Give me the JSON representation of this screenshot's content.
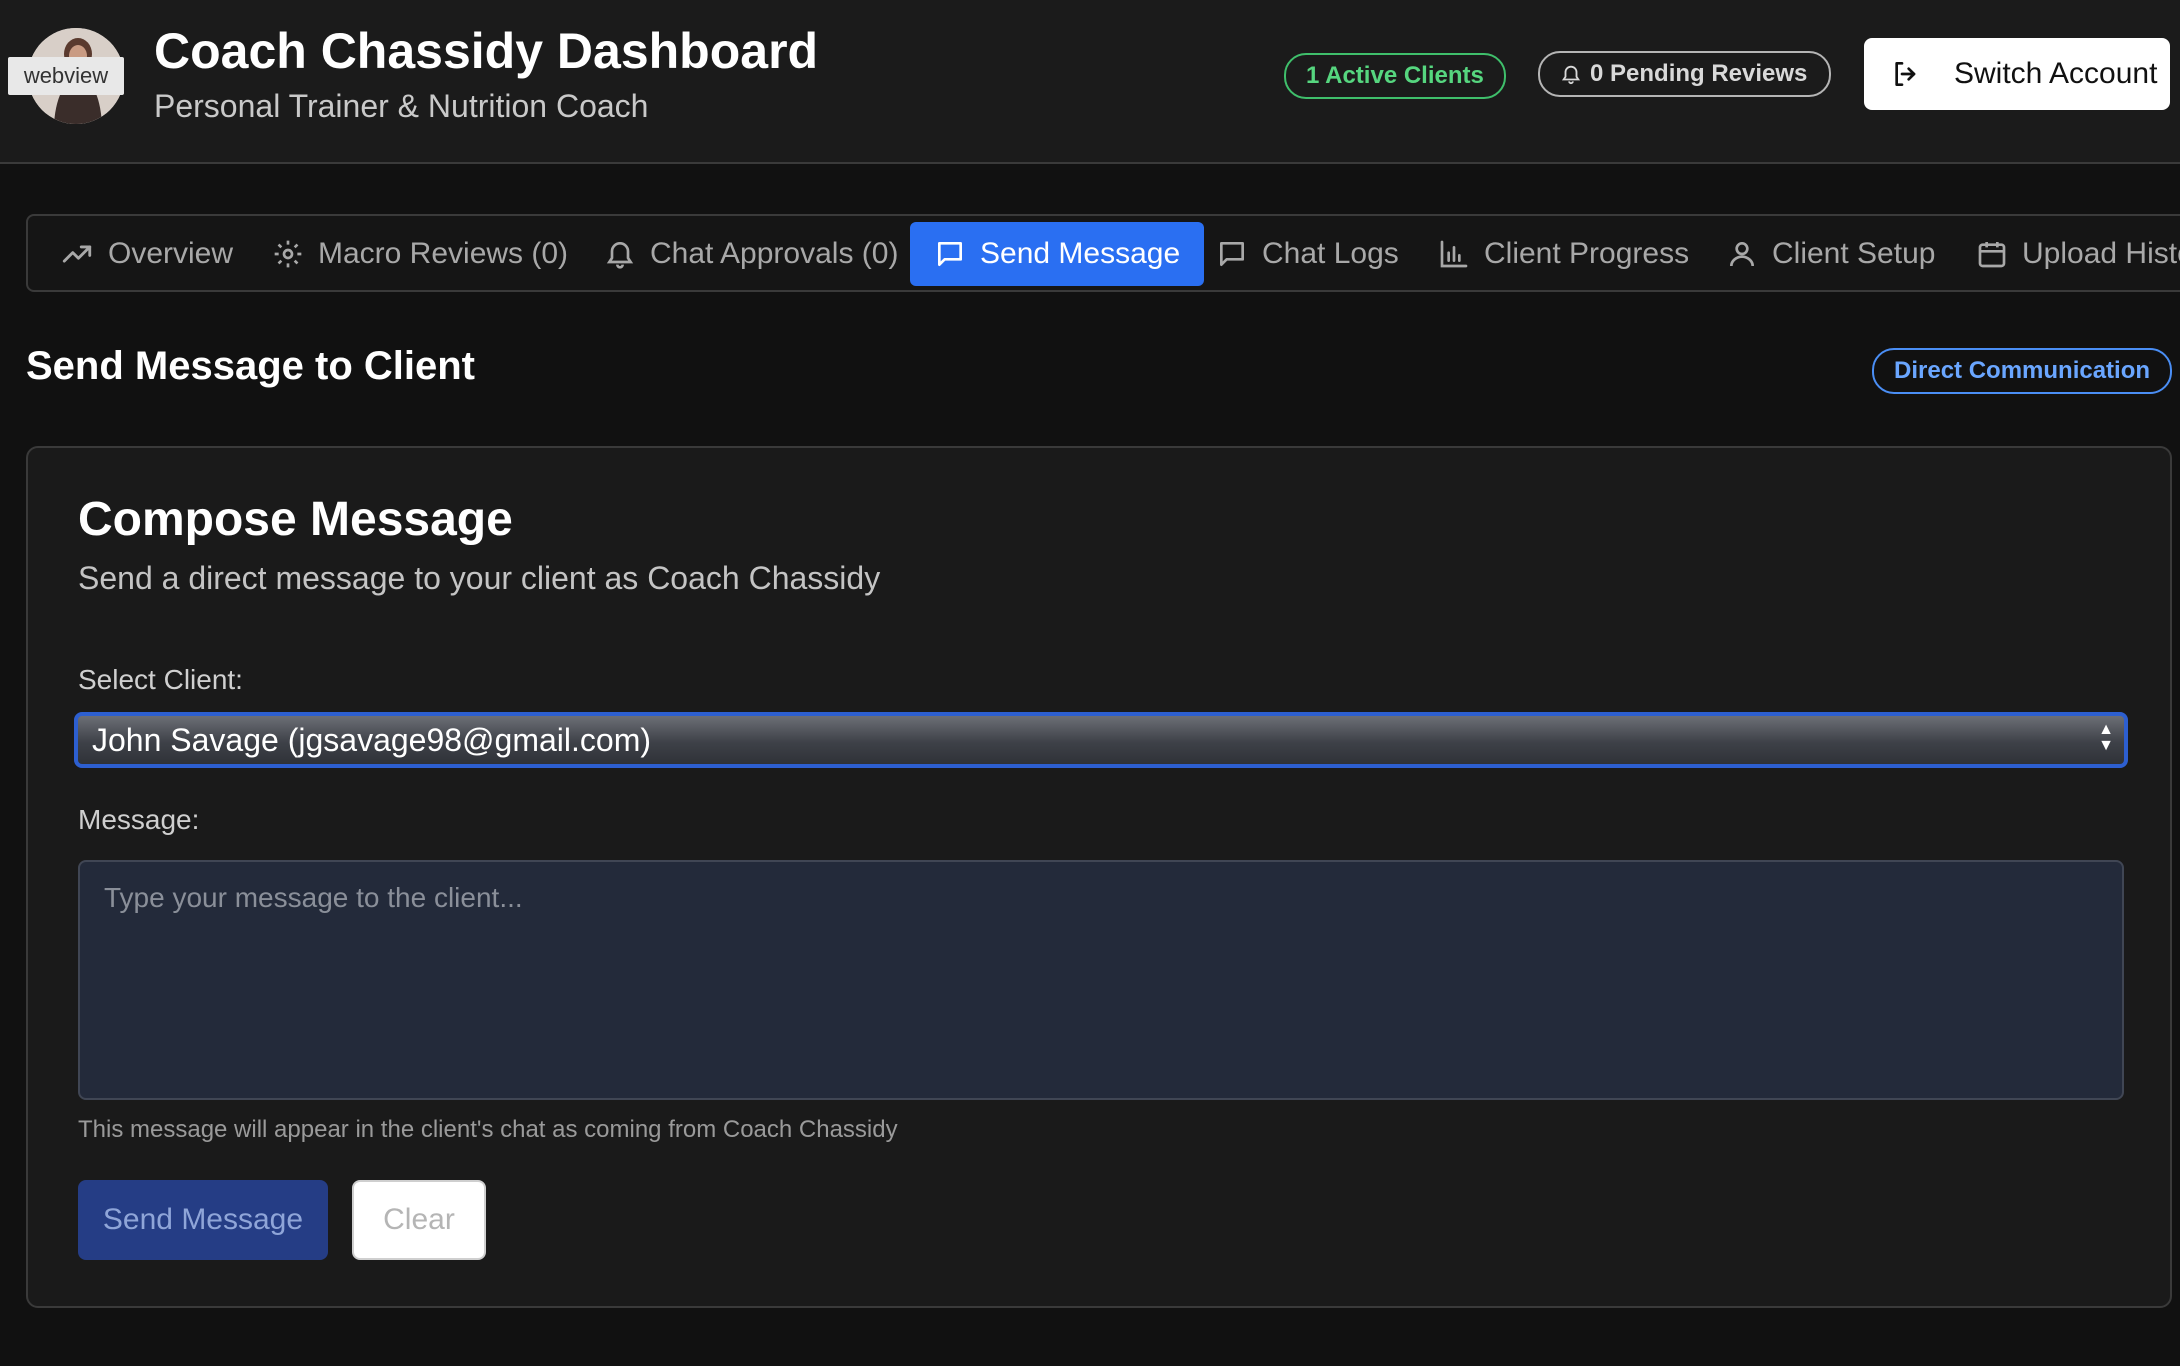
{
  "header": {
    "avatar_label": "webview",
    "title": "Coach Chassidy Dashboard",
    "subtitle": "Personal Trainer & Nutrition Coach",
    "active_clients_badge": "1 Active Clients",
    "pending_reviews_badge": "0 Pending Reviews",
    "switch_account_label": "Switch Account"
  },
  "tabs": [
    {
      "label": "Overview",
      "icon": "trending-up-icon"
    },
    {
      "label": "Macro Reviews (0)",
      "icon": "gear-icon"
    },
    {
      "label": "Chat Approvals (0)",
      "icon": "bell-icon"
    },
    {
      "label": "Send Message",
      "icon": "chat-bubble-icon",
      "active": true
    },
    {
      "label": "Chat Logs",
      "icon": "chat-bubble-icon"
    },
    {
      "label": "Client Progress",
      "icon": "bar-chart-icon"
    },
    {
      "label": "Client Setup",
      "icon": "user-icon"
    },
    {
      "label": "Upload Histo",
      "icon": "calendar-icon"
    }
  ],
  "section": {
    "title": "Send Message to Client",
    "badge": "Direct Communication"
  },
  "compose": {
    "title": "Compose Message",
    "description": "Send a direct message to your client as Coach Chassidy",
    "client_label": "Select Client:",
    "client_selected": "John Savage (jgsavage98@gmail.com)",
    "message_label": "Message:",
    "message_placeholder": "Type your message to the client...",
    "hint": "This message will appear in the client's chat as coming from Coach Chassidy",
    "send_label": "Send Message",
    "clear_label": "Clear"
  },
  "colors": {
    "active_tab": "#2a6ff2",
    "active_clients": "#56d67f",
    "direct_badge": "#6aa6ff",
    "send_button": "#253d85"
  }
}
